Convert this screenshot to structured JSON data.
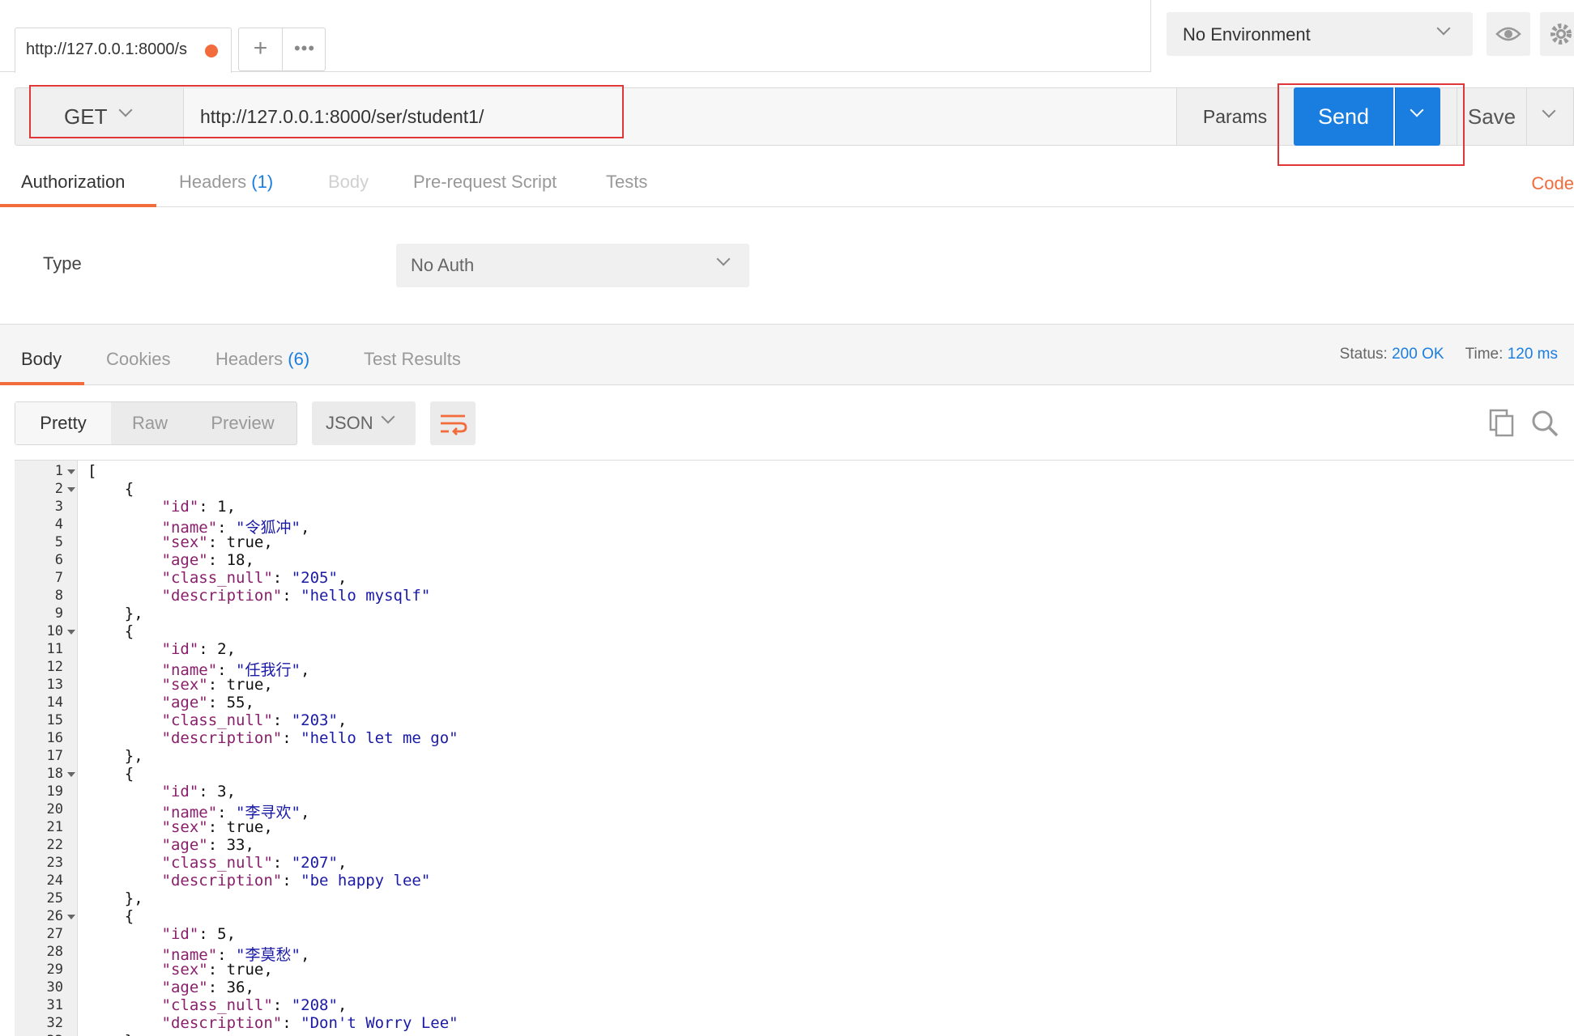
{
  "tabs": {
    "active_url": "http://127.0.0.1:8000/s",
    "new_tab": "+",
    "more": "•••"
  },
  "environment": {
    "selected": "No Environment"
  },
  "request": {
    "method": "GET",
    "url": "http://127.0.0.1:8000/ser/student1/",
    "params_label": "Params",
    "send_label": "Send",
    "save_label": "Save"
  },
  "request_tabs": {
    "authorization": "Authorization",
    "headers": "Headers",
    "headers_count": "(1)",
    "body": "Body",
    "pre_request": "Pre-request Script",
    "tests": "Tests",
    "code": "Code"
  },
  "auth": {
    "type_label": "Type",
    "type_value": "No Auth"
  },
  "response_tabs": {
    "body": "Body",
    "cookies": "Cookies",
    "headers": "Headers",
    "headers_count": "(6)",
    "test_results": "Test Results"
  },
  "response_status": {
    "status_label": "Status:",
    "status_value": "200 OK",
    "time_label": "Time:",
    "time_value": "120 ms"
  },
  "viewer": {
    "pretty": "Pretty",
    "raw": "Raw",
    "preview": "Preview",
    "format": "JSON"
  },
  "response_body": [
    {
      "id": "1",
      "name": "\"令狐冲\"",
      "sex": "true",
      "age": "18",
      "class_null": "\"205\"",
      "description": "\"hello mysqlf\""
    },
    {
      "id": "2",
      "name": "\"任我行\"",
      "sex": "true",
      "age": "55",
      "class_null": "\"203\"",
      "description": "\"hello let me go\""
    },
    {
      "id": "3",
      "name": "\"李寻欢\"",
      "sex": "true",
      "age": "33",
      "class_null": "\"207\"",
      "description": "\"be happy lee\""
    },
    {
      "id": "5",
      "name": "\"李莫愁\"",
      "sex": "true",
      "age": "36",
      "class_null": "\"208\"",
      "description": "\"Don't Worry Lee\""
    }
  ],
  "colors": {
    "accent_orange": "#f26b3a",
    "send_blue": "#1a7ee0",
    "highlight_red": "#e0363a",
    "json_key": "#8a1f6b",
    "json_string": "#1a1aa6"
  }
}
